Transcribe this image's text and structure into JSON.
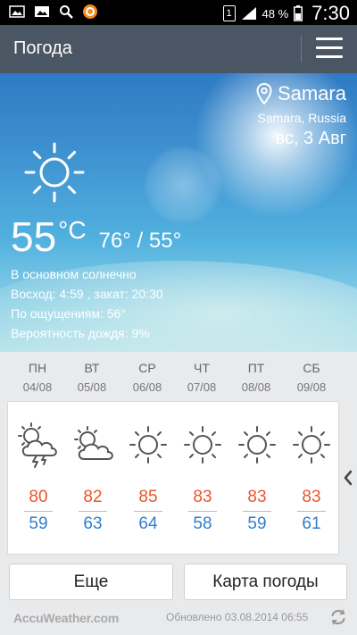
{
  "status_bar": {
    "battery": "48 %",
    "time": "7:30",
    "sim": "1"
  },
  "app_bar": {
    "title": "Погода"
  },
  "current": {
    "city": "Samara",
    "region": "Samara, Russia",
    "date": "вс, 3 Авг",
    "temp": "55",
    "unit": "°C",
    "hi_lo": "76° / 55°",
    "condition": "В основном солнечно",
    "sunrise_sunset": "Восход: 4:59 , закат: 20:30",
    "feels_like": "По ощущениям: 56°",
    "rain_chance": "Вероятность дождя: 9%",
    "icon": "sun-icon"
  },
  "forecast": [
    {
      "day": "ПН",
      "date": "04/08",
      "hi": "80",
      "lo": "59",
      "icon": "thunderstorm-icon"
    },
    {
      "day": "ВТ",
      "date": "05/08",
      "hi": "82",
      "lo": "63",
      "icon": "partly-cloudy-icon"
    },
    {
      "day": "СР",
      "date": "06/08",
      "hi": "85",
      "lo": "64",
      "icon": "sun-icon"
    },
    {
      "day": "ЧТ",
      "date": "07/08",
      "hi": "83",
      "lo": "58",
      "icon": "sun-icon"
    },
    {
      "day": "ПТ",
      "date": "08/08",
      "hi": "83",
      "lo": "59",
      "icon": "sun-icon"
    },
    {
      "day": "СБ",
      "date": "09/08",
      "hi": "83",
      "lo": "61",
      "icon": "sun-icon"
    }
  ],
  "buttons": {
    "more": "Еще",
    "map": "Карта погоды"
  },
  "footer": {
    "brand": "AccuWeather.com",
    "updated": "Обновлено 03.08.2014 06:55"
  },
  "colors": {
    "app_bar": "#4a5663",
    "high_temp": "#e8572a",
    "low_temp": "#2f7ed0"
  }
}
